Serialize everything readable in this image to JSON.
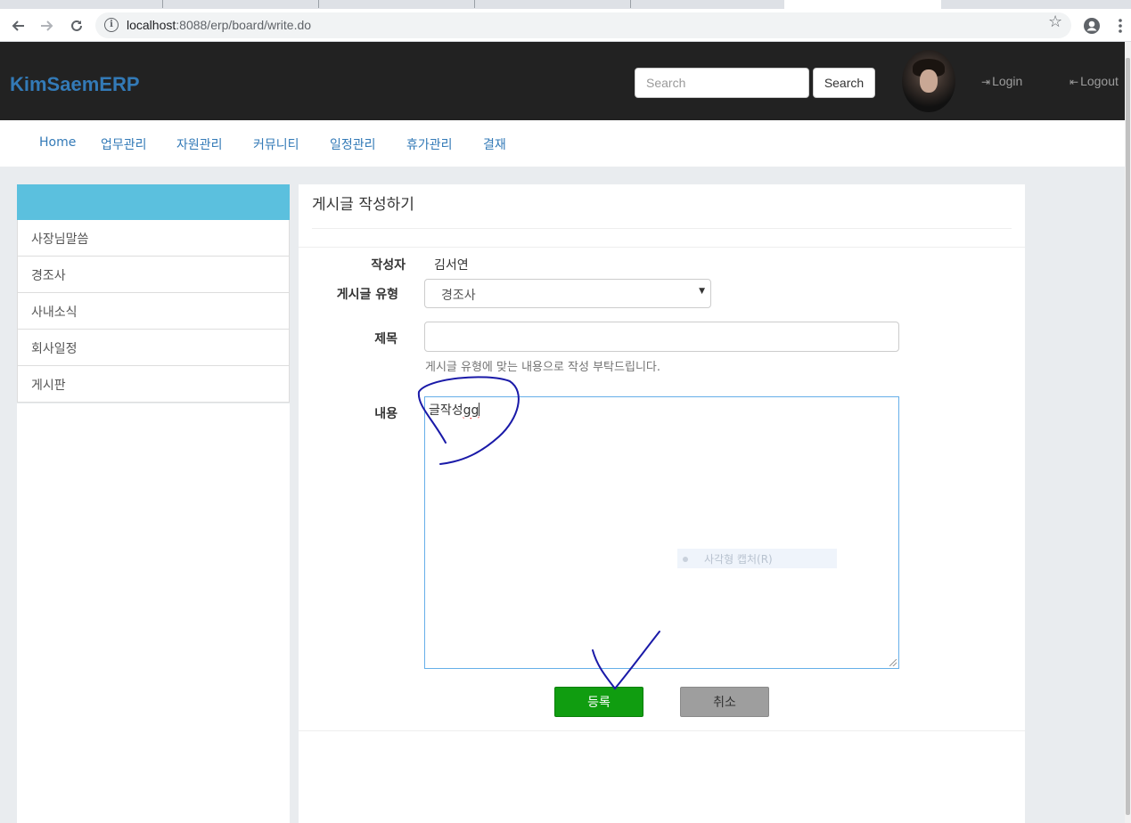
{
  "browser": {
    "url_host": "localhost",
    "url_path": ":8088/erp/board/write.do"
  },
  "navbar": {
    "brand": "KimSaemERP",
    "search_placeholder": "Search",
    "search_button": "Search",
    "login_label": "Login",
    "logout_label": "Logout"
  },
  "menu": {
    "items": [
      "Home",
      "업무관리",
      "자원관리",
      "커뮤니티",
      "일정관리",
      "휴가관리",
      "결재"
    ]
  },
  "sidebar": {
    "items": [
      "사장님말씀",
      "경조사",
      "사내소식",
      "회사일정",
      "게시판"
    ]
  },
  "form": {
    "page_title": "게시글 작성하기",
    "writer_label": "작성자",
    "writer_value": "김서연",
    "type_label": "게시글 유형",
    "type_value": "경조사",
    "title_label": "제목",
    "title_value": "",
    "title_help": "게시글 유형에 맞는 내용으로 작성 부탁드립니다.",
    "content_label": "내용",
    "content_text": "글작성",
    "content_misspelled": "gg",
    "context_menu_item": "사각형 캡처(R)",
    "submit_label": "등록",
    "cancel_label": "취소"
  },
  "colors": {
    "brand": "#337ab7",
    "navbar_bg": "#222222",
    "sidebar_header": "#5bc0de",
    "submit_button": "#109d10",
    "cancel_button": "#9e9e9e",
    "annotation_ink": "#1a1aa8"
  }
}
